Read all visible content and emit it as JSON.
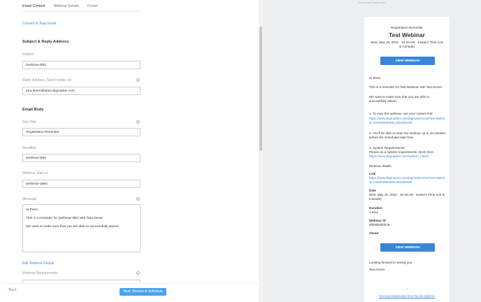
{
  "tabs": [
    {
      "label": "Email Content"
    },
    {
      "label": "Webinar Details"
    },
    {
      "label": "Footer"
    }
  ],
  "convert_link": "Convert to Raw Email",
  "subject_section": {
    "heading": "Subject & Reply Address",
    "subject_label": "Subject",
    "subject_value": "{webinar-title}",
    "reply_label": "Reply Address (Send replies to)",
    "reply_value": "tara.dover@team.bigmarker.com"
  },
  "body_section": {
    "heading": "Email Body",
    "subtitle_label": "Sub-Title",
    "subtitle_value": "Registration Reminder",
    "headline_label": "Headline",
    "headline_value": "{webinar-title}",
    "start_label": "Webinar Start at",
    "start_value": "{webinar-date}",
    "message_label": "Message",
    "message_lines": [
      "Hi there,",
      "This is a reminder for {webinar-title} with Tara Dover.",
      "We want to make sure that you are able to successfully attend."
    ],
    "edit_details_link": "Edit Webinar Details",
    "requirements_label": "Webinar Requirements"
  },
  "footer": {
    "back_label": "← Back",
    "next_label": "Next: Review & Schedule"
  },
  "preview": {
    "top_note_1": "...",
    "top_note_2": "Send a test to see it live.",
    "subtitle": "Registration Reminder",
    "title": "Test Webinar",
    "date": "Wed, May 25, 2022 · 10:30 AM · Eastern Time (US & Canada)",
    "button": "VIEW WEBINAR",
    "greeting": "Hi there,",
    "reminder": "This is a reminder for Test Webinar with Tara Dover.",
    "attend": "We want to make sure that you are able to successfully attend.",
    "step1": "1. To view this webinar, use your custom link:",
    "step1_link": "https://www.bigmarker.com/bigmarker102/Test-Webinar-13e9f2999486c16bed8180f",
    "step2": "2. You'll be able to enter the webinar up to 15 minutes before the scheduled start time.",
    "step3": "3. System Requirements:",
    "step3_text": "Please do a system requirements check here",
    "step3_link": "https://www.bigmarker.com/system_check",
    "details_heading": "Webinar details:",
    "link_label": "Link",
    "link_value": "https://www.bigmarker.com/bigmarker102/Test-Webinar-13e9f2999486c16bed8180f",
    "date_label": "Date",
    "date_value": "Wed, May 25, 2022 · 10:30 AM · Eastern Time (US & Canada)",
    "duration_label": "Duration",
    "duration_value": "1 hour",
    "id_label": "Webinar ID",
    "id_value": "9f028b4b0b78",
    "about_label": "About",
    "button2": "VIEW WEBINAR",
    "looking_forward": "Looking forward to seeing you,",
    "signature": "Tara Dover",
    "unsubscribe": "You may unsubscribe from this list anytime."
  }
}
